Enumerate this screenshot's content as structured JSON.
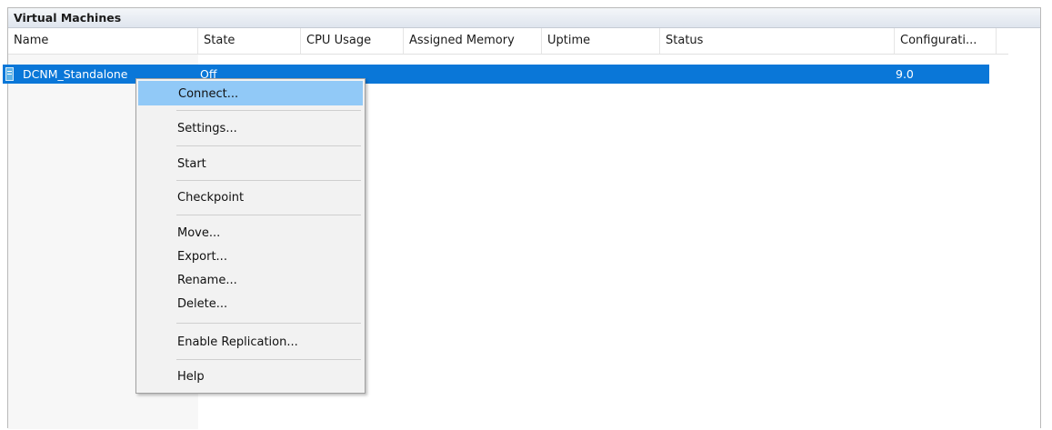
{
  "panel": {
    "title": "Virtual Machines"
  },
  "columns": [
    {
      "label": "Name"
    },
    {
      "label": "State"
    },
    {
      "label": "CPU Usage"
    },
    {
      "label": "Assigned Memory"
    },
    {
      "label": "Uptime"
    },
    {
      "label": "Status"
    },
    {
      "label": "Configurati..."
    }
  ],
  "sort_indicator": "^",
  "vms": [
    {
      "name": "DCNM_Standalone",
      "state": "Off",
      "configuration": "9.0",
      "icon": "virtual-machine-icon"
    }
  ],
  "context_menu": {
    "items": [
      {
        "label": "Connect..."
      },
      {
        "label": "Settings..."
      },
      {
        "label": "Start"
      },
      {
        "label": "Checkpoint"
      },
      {
        "label": "Move..."
      },
      {
        "label": "Export..."
      },
      {
        "label": "Rename..."
      },
      {
        "label": "Delete..."
      },
      {
        "label": "Enable Replication..."
      },
      {
        "label": "Help"
      }
    ]
  },
  "colors": {
    "selection": "#0a77d8",
    "menu_highlight": "#91c9f7",
    "menu_background": "#f2f2f2"
  }
}
